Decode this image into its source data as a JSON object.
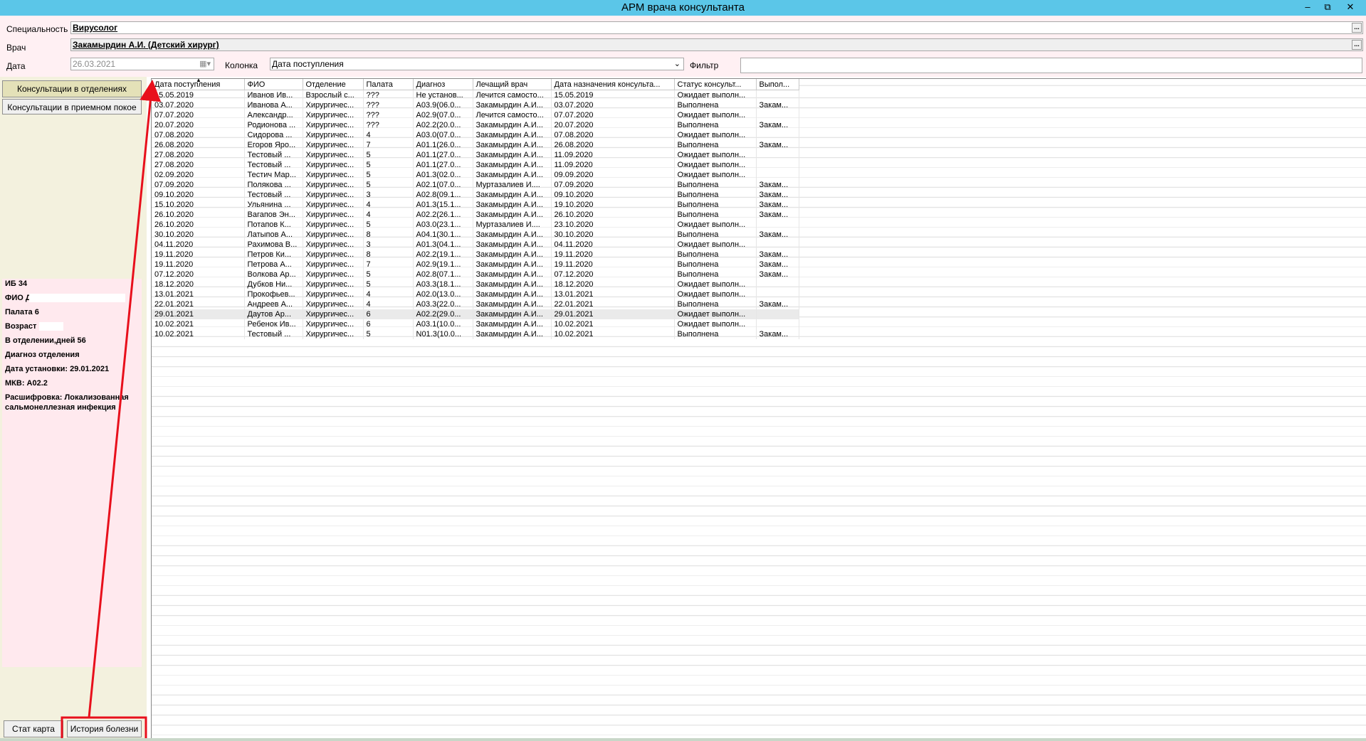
{
  "window": {
    "title": "АРМ врача консультанта",
    "min": "–",
    "restore": "⧉",
    "close": "✕"
  },
  "header": {
    "specialty_label": "Специальность",
    "specialty_value": "Вирусолог",
    "doctor_label": "Врач",
    "doctor_value": "Закамырдин А.И. (Детский хирург)",
    "date_label": "Дата",
    "date_value": "26.03.2021",
    "column_label": "Колонка",
    "column_value": "Дата поступления",
    "filter_label": "Фильтр",
    "filter_value": "",
    "ellipsis": "..."
  },
  "nav": {
    "dept_consults": "Консультации в отделениях",
    "er_consults": "Консультации в приемном покое"
  },
  "info": {
    "ib": "ИБ 34",
    "fio": "ФИО Д",
    "ward": "Палата 6",
    "age": "Возраст",
    "days": "В отделении,дней 56",
    "dept_diag": "Диагноз отделения",
    "set_date": "Дата установки: 29.01.2021",
    "mkb": "МКВ: A02.2",
    "decode1": "Расшифровка: Локализованная",
    "decode2": "сальмонеллезная инфекция"
  },
  "buttons": {
    "stat_card": "Стат карта",
    "history": "История болезни"
  },
  "table": {
    "columns": [
      "Дата поступления",
      "ФИО",
      "Отделение",
      "Палата",
      "Диагноз",
      "Лечащий врач",
      "Дата назначения консульта...",
      "Статус консульт...",
      "Выпол..."
    ],
    "rows": [
      [
        "15.05.2019",
        "Иванов Ив...",
        "Взрослый с...",
        "???",
        "Не установ...",
        "Лечится самосто...",
        "15.05.2019",
        "Ожидает выполн...",
        ""
      ],
      [
        "03.07.2020",
        "Иванова А...",
        "Хирургичес...",
        "???",
        "A03.9(06.0...",
        "Закамырдин А.И...",
        "03.07.2020",
        "Выполнена",
        "Закам..."
      ],
      [
        "07.07.2020",
        "Александр...",
        "Хирургичес...",
        "???",
        "A02.9(07.0...",
        "Лечится самосто...",
        "07.07.2020",
        "Ожидает выполн...",
        ""
      ],
      [
        "20.07.2020",
        "Родионова ...",
        "Хирургичес...",
        "???",
        "A02.2(20.0...",
        "Закамырдин А.И...",
        "20.07.2020",
        "Выполнена",
        "Закам..."
      ],
      [
        "07.08.2020",
        "Сидорова ...",
        "Хирургичес...",
        "4",
        "A03.0(07.0...",
        "Закамырдин А.И...",
        "07.08.2020",
        "Ожидает выполн...",
        ""
      ],
      [
        "26.08.2020",
        "Егоров Яро...",
        "Хирургичес...",
        "7",
        "A01.1(26.0...",
        "Закамырдин А.И...",
        "26.08.2020",
        "Выполнена",
        "Закам..."
      ],
      [
        "27.08.2020",
        "Тестовый ...",
        "Хирургичес...",
        "5",
        "A01.1(27.0...",
        "Закамырдин А.И...",
        "11.09.2020",
        "Ожидает выполн...",
        ""
      ],
      [
        "27.08.2020",
        "Тестовый ...",
        "Хирургичес...",
        "5",
        "A01.1(27.0...",
        "Закамырдин А.И...",
        "11.09.2020",
        "Ожидает выполн...",
        ""
      ],
      [
        "02.09.2020",
        "Тестич Мар...",
        "Хирургичес...",
        "5",
        "A01.3(02.0...",
        "Закамырдин А.И...",
        "09.09.2020",
        "Ожидает выполн...",
        ""
      ],
      [
        "07.09.2020",
        "Полякова ...",
        "Хирургичес...",
        "5",
        "A02.1(07.0...",
        "Муртазалиев И....",
        "07.09.2020",
        "Выполнена",
        "Закам..."
      ],
      [
        "09.10.2020",
        "Тестовый ...",
        "Хирургичес...",
        "3",
        "A02.8(09.1...",
        "Закамырдин А.И...",
        "09.10.2020",
        "Выполнена",
        "Закам..."
      ],
      [
        "15.10.2020",
        "Ульянина ...",
        "Хирургичес...",
        "4",
        "A01.3(15.1...",
        "Закамырдин А.И...",
        "19.10.2020",
        "Выполнена",
        "Закам..."
      ],
      [
        "26.10.2020",
        "Вагапов Эн...",
        "Хирургичес...",
        "4",
        "A02.2(26.1...",
        "Закамырдин А.И...",
        "26.10.2020",
        "Выполнена",
        "Закам..."
      ],
      [
        "26.10.2020",
        "Потапов К...",
        "Хирургичес...",
        "5",
        "A03.0(23.1...",
        "Муртазалиев И....",
        "23.10.2020",
        "Ожидает выполн...",
        ""
      ],
      [
        "30.10.2020",
        "Латыпов А...",
        "Хирургичес...",
        "8",
        "A04.1(30.1...",
        "Закамырдин А.И...",
        "30.10.2020",
        "Выполнена",
        "Закам..."
      ],
      [
        "04.11.2020",
        "Рахимова В...",
        "Хирургичес...",
        "3",
        "A01.3(04.1...",
        "Закамырдин А.И...",
        "04.11.2020",
        "Ожидает выполн...",
        ""
      ],
      [
        "19.11.2020",
        "Петров Ки...",
        "Хирургичес...",
        "8",
        "A02.2(19.1...",
        "Закамырдин А.И...",
        "19.11.2020",
        "Выполнена",
        "Закам..."
      ],
      [
        "19.11.2020",
        "Петрова А...",
        "Хирургичес...",
        "7",
        "A02.9(19.1...",
        "Закамырдин А.И...",
        "19.11.2020",
        "Выполнена",
        "Закам..."
      ],
      [
        "07.12.2020",
        "Волкова Ар...",
        "Хирургичес...",
        "5",
        "A02.8(07.1...",
        "Закамырдин А.И...",
        "07.12.2020",
        "Выполнена",
        "Закам..."
      ],
      [
        "18.12.2020",
        "Дубков Ни...",
        "Хирургичес...",
        "5",
        "A03.3(18.1...",
        "Закамырдин А.И...",
        "18.12.2020",
        "Ожидает выполн...",
        ""
      ],
      [
        "13.01.2021",
        "Прокофьев...",
        "Хирургичес...",
        "4",
        "A02.0(13.0...",
        "Закамырдин А.И...",
        "13.01.2021",
        "Ожидает выполн...",
        ""
      ],
      [
        "22.01.2021",
        "Андреев А...",
        "Хирургичес...",
        "4",
        "A03.3(22.0...",
        "Закамырдин А.И...",
        "22.01.2021",
        "Выполнена",
        "Закам..."
      ],
      [
        "29.01.2021",
        "Даутов Ар...",
        "Хирургичес...",
        "6",
        "A02.2(29.0...",
        "Закамырдин А.И...",
        "29.01.2021",
        "Ожидает выполн...",
        ""
      ],
      [
        "10.02.2021",
        "Ребенок Ив...",
        "Хирургичес...",
        "6",
        "A03.1(10.0...",
        "Закамырдин А.И...",
        "10.02.2021",
        "Ожидает выполн...",
        ""
      ],
      [
        "10.02.2021",
        "Тестовый ...",
        "Хирургичес...",
        "5",
        "N01.3(10.0...",
        "Закамырдин А.И...",
        "10.02.2021",
        "Выполнена",
        "Закам..."
      ]
    ],
    "selected_row": 22
  },
  "annotation_color": "#e8101c"
}
